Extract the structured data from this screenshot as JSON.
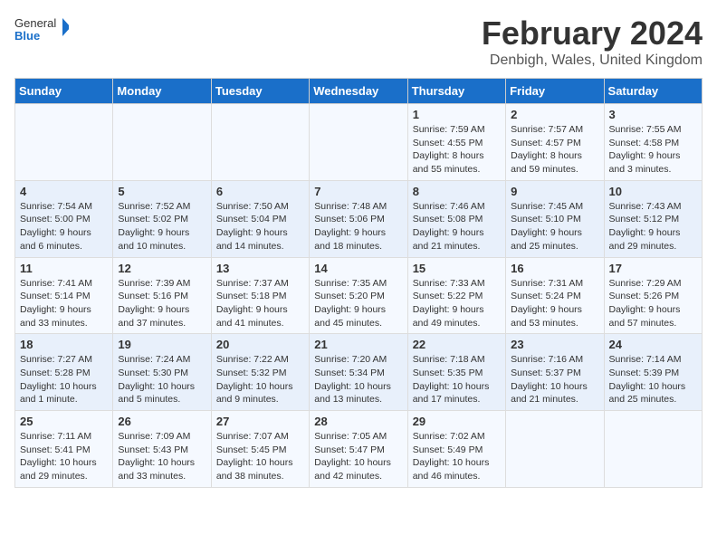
{
  "header": {
    "logo_general": "General",
    "logo_blue": "Blue",
    "month_year": "February 2024",
    "location": "Denbigh, Wales, United Kingdom"
  },
  "days_of_week": [
    "Sunday",
    "Monday",
    "Tuesday",
    "Wednesday",
    "Thursday",
    "Friday",
    "Saturday"
  ],
  "weeks": [
    [
      {
        "day": "",
        "info": ""
      },
      {
        "day": "",
        "info": ""
      },
      {
        "day": "",
        "info": ""
      },
      {
        "day": "",
        "info": ""
      },
      {
        "day": "1",
        "info": "Sunrise: 7:59 AM\nSunset: 4:55 PM\nDaylight: 8 hours and 55 minutes."
      },
      {
        "day": "2",
        "info": "Sunrise: 7:57 AM\nSunset: 4:57 PM\nDaylight: 8 hours and 59 minutes."
      },
      {
        "day": "3",
        "info": "Sunrise: 7:55 AM\nSunset: 4:58 PM\nDaylight: 9 hours and 3 minutes."
      }
    ],
    [
      {
        "day": "4",
        "info": "Sunrise: 7:54 AM\nSunset: 5:00 PM\nDaylight: 9 hours and 6 minutes."
      },
      {
        "day": "5",
        "info": "Sunrise: 7:52 AM\nSunset: 5:02 PM\nDaylight: 9 hours and 10 minutes."
      },
      {
        "day": "6",
        "info": "Sunrise: 7:50 AM\nSunset: 5:04 PM\nDaylight: 9 hours and 14 minutes."
      },
      {
        "day": "7",
        "info": "Sunrise: 7:48 AM\nSunset: 5:06 PM\nDaylight: 9 hours and 18 minutes."
      },
      {
        "day": "8",
        "info": "Sunrise: 7:46 AM\nSunset: 5:08 PM\nDaylight: 9 hours and 21 minutes."
      },
      {
        "day": "9",
        "info": "Sunrise: 7:45 AM\nSunset: 5:10 PM\nDaylight: 9 hours and 25 minutes."
      },
      {
        "day": "10",
        "info": "Sunrise: 7:43 AM\nSunset: 5:12 PM\nDaylight: 9 hours and 29 minutes."
      }
    ],
    [
      {
        "day": "11",
        "info": "Sunrise: 7:41 AM\nSunset: 5:14 PM\nDaylight: 9 hours and 33 minutes."
      },
      {
        "day": "12",
        "info": "Sunrise: 7:39 AM\nSunset: 5:16 PM\nDaylight: 9 hours and 37 minutes."
      },
      {
        "day": "13",
        "info": "Sunrise: 7:37 AM\nSunset: 5:18 PM\nDaylight: 9 hours and 41 minutes."
      },
      {
        "day": "14",
        "info": "Sunrise: 7:35 AM\nSunset: 5:20 PM\nDaylight: 9 hours and 45 minutes."
      },
      {
        "day": "15",
        "info": "Sunrise: 7:33 AM\nSunset: 5:22 PM\nDaylight: 9 hours and 49 minutes."
      },
      {
        "day": "16",
        "info": "Sunrise: 7:31 AM\nSunset: 5:24 PM\nDaylight: 9 hours and 53 minutes."
      },
      {
        "day": "17",
        "info": "Sunrise: 7:29 AM\nSunset: 5:26 PM\nDaylight: 9 hours and 57 minutes."
      }
    ],
    [
      {
        "day": "18",
        "info": "Sunrise: 7:27 AM\nSunset: 5:28 PM\nDaylight: 10 hours and 1 minute."
      },
      {
        "day": "19",
        "info": "Sunrise: 7:24 AM\nSunset: 5:30 PM\nDaylight: 10 hours and 5 minutes."
      },
      {
        "day": "20",
        "info": "Sunrise: 7:22 AM\nSunset: 5:32 PM\nDaylight: 10 hours and 9 minutes."
      },
      {
        "day": "21",
        "info": "Sunrise: 7:20 AM\nSunset: 5:34 PM\nDaylight: 10 hours and 13 minutes."
      },
      {
        "day": "22",
        "info": "Sunrise: 7:18 AM\nSunset: 5:35 PM\nDaylight: 10 hours and 17 minutes."
      },
      {
        "day": "23",
        "info": "Sunrise: 7:16 AM\nSunset: 5:37 PM\nDaylight: 10 hours and 21 minutes."
      },
      {
        "day": "24",
        "info": "Sunrise: 7:14 AM\nSunset: 5:39 PM\nDaylight: 10 hours and 25 minutes."
      }
    ],
    [
      {
        "day": "25",
        "info": "Sunrise: 7:11 AM\nSunset: 5:41 PM\nDaylight: 10 hours and 29 minutes."
      },
      {
        "day": "26",
        "info": "Sunrise: 7:09 AM\nSunset: 5:43 PM\nDaylight: 10 hours and 33 minutes."
      },
      {
        "day": "27",
        "info": "Sunrise: 7:07 AM\nSunset: 5:45 PM\nDaylight: 10 hours and 38 minutes."
      },
      {
        "day": "28",
        "info": "Sunrise: 7:05 AM\nSunset: 5:47 PM\nDaylight: 10 hours and 42 minutes."
      },
      {
        "day": "29",
        "info": "Sunrise: 7:02 AM\nSunset: 5:49 PM\nDaylight: 10 hours and 46 minutes."
      },
      {
        "day": "",
        "info": ""
      },
      {
        "day": "",
        "info": ""
      }
    ]
  ]
}
